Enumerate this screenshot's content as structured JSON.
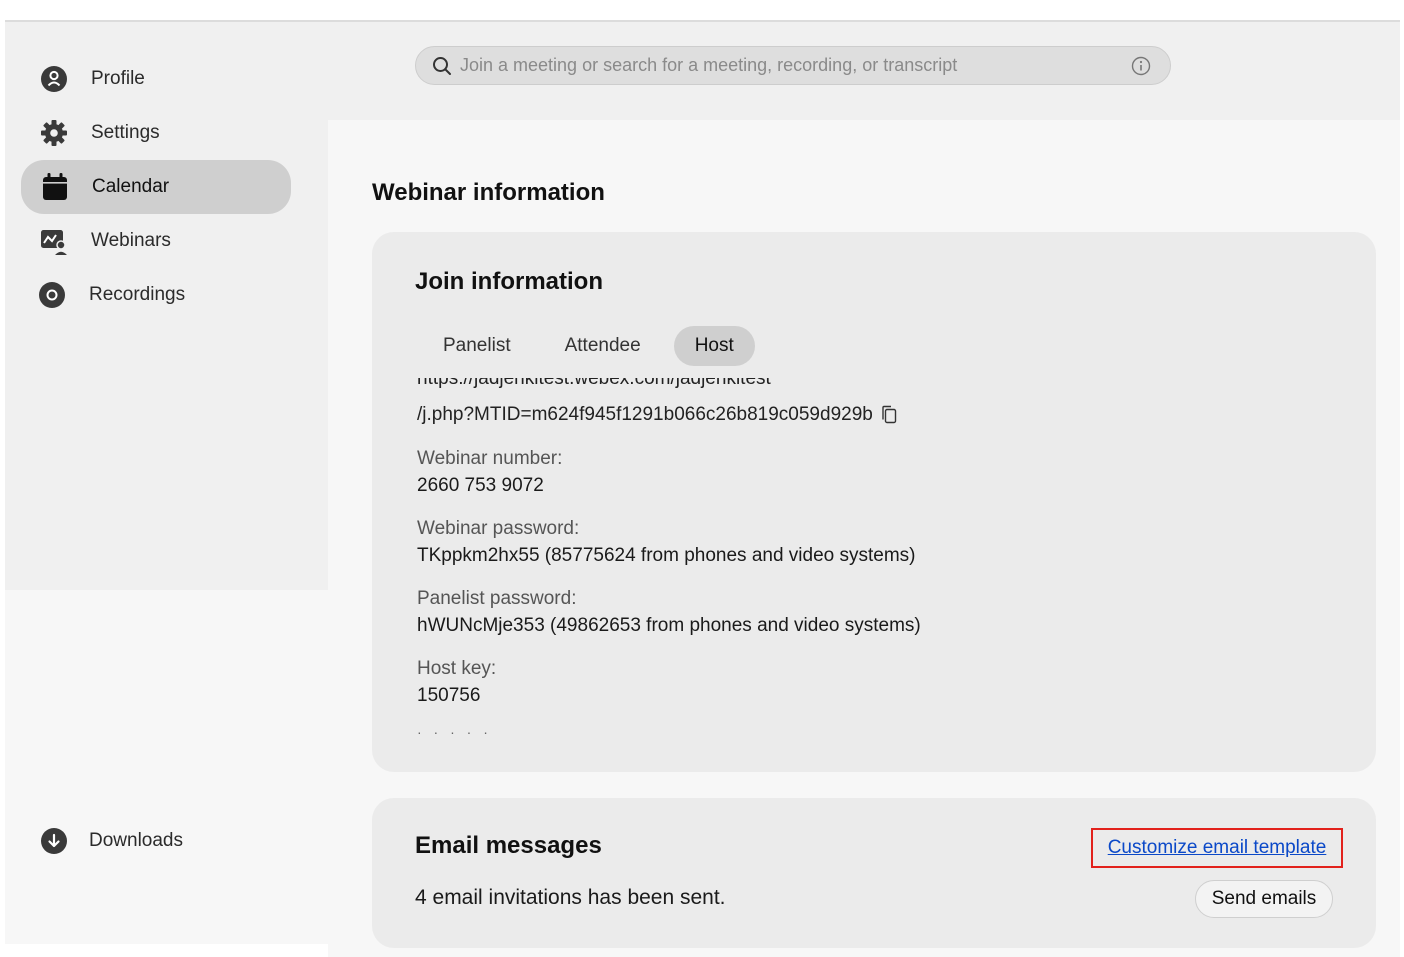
{
  "search": {
    "placeholder": "Join a meeting or search for a meeting, recording, or transcript"
  },
  "sidebar": {
    "items": [
      {
        "label": "Profile",
        "icon": "profile-icon"
      },
      {
        "label": "Settings",
        "icon": "gear-icon"
      },
      {
        "label": "Calendar",
        "icon": "calendar-icon",
        "active": true
      },
      {
        "label": "Webinars",
        "icon": "webinar-icon"
      },
      {
        "label": "Recordings",
        "icon": "recordings-icon"
      }
    ],
    "downloads_label": "Downloads"
  },
  "main": {
    "page_title": "Webinar information",
    "join": {
      "title": "Join information",
      "tabs": [
        "Panelist",
        "Attendee",
        "Host"
      ],
      "active_tab": "Host",
      "url_line1": "https://jadjenkitest.webex.com/jadjenkitest",
      "url_line2": "/j.php?MTID=m624f945f1291b066c26b819c059d929b",
      "webinar_number_label": "Webinar number:",
      "webinar_number": "2660 753 9072",
      "webinar_password_label": "Webinar password:",
      "webinar_password": "TKppkm2hx55 (85775624 from phones and video systems)",
      "panelist_password_label": "Panelist password:",
      "panelist_password": "hWUNcMje353 (49862653 from phones and video systems)",
      "host_key_label": "Host key:",
      "host_key": "150756"
    },
    "email": {
      "title": "Email messages",
      "customize_link": "Customize email template",
      "status": "4 email invitations has been sent.",
      "send_button": "Send emails"
    }
  },
  "colors": {
    "highlight_border": "#e2211c",
    "link": "#0a48c8"
  }
}
